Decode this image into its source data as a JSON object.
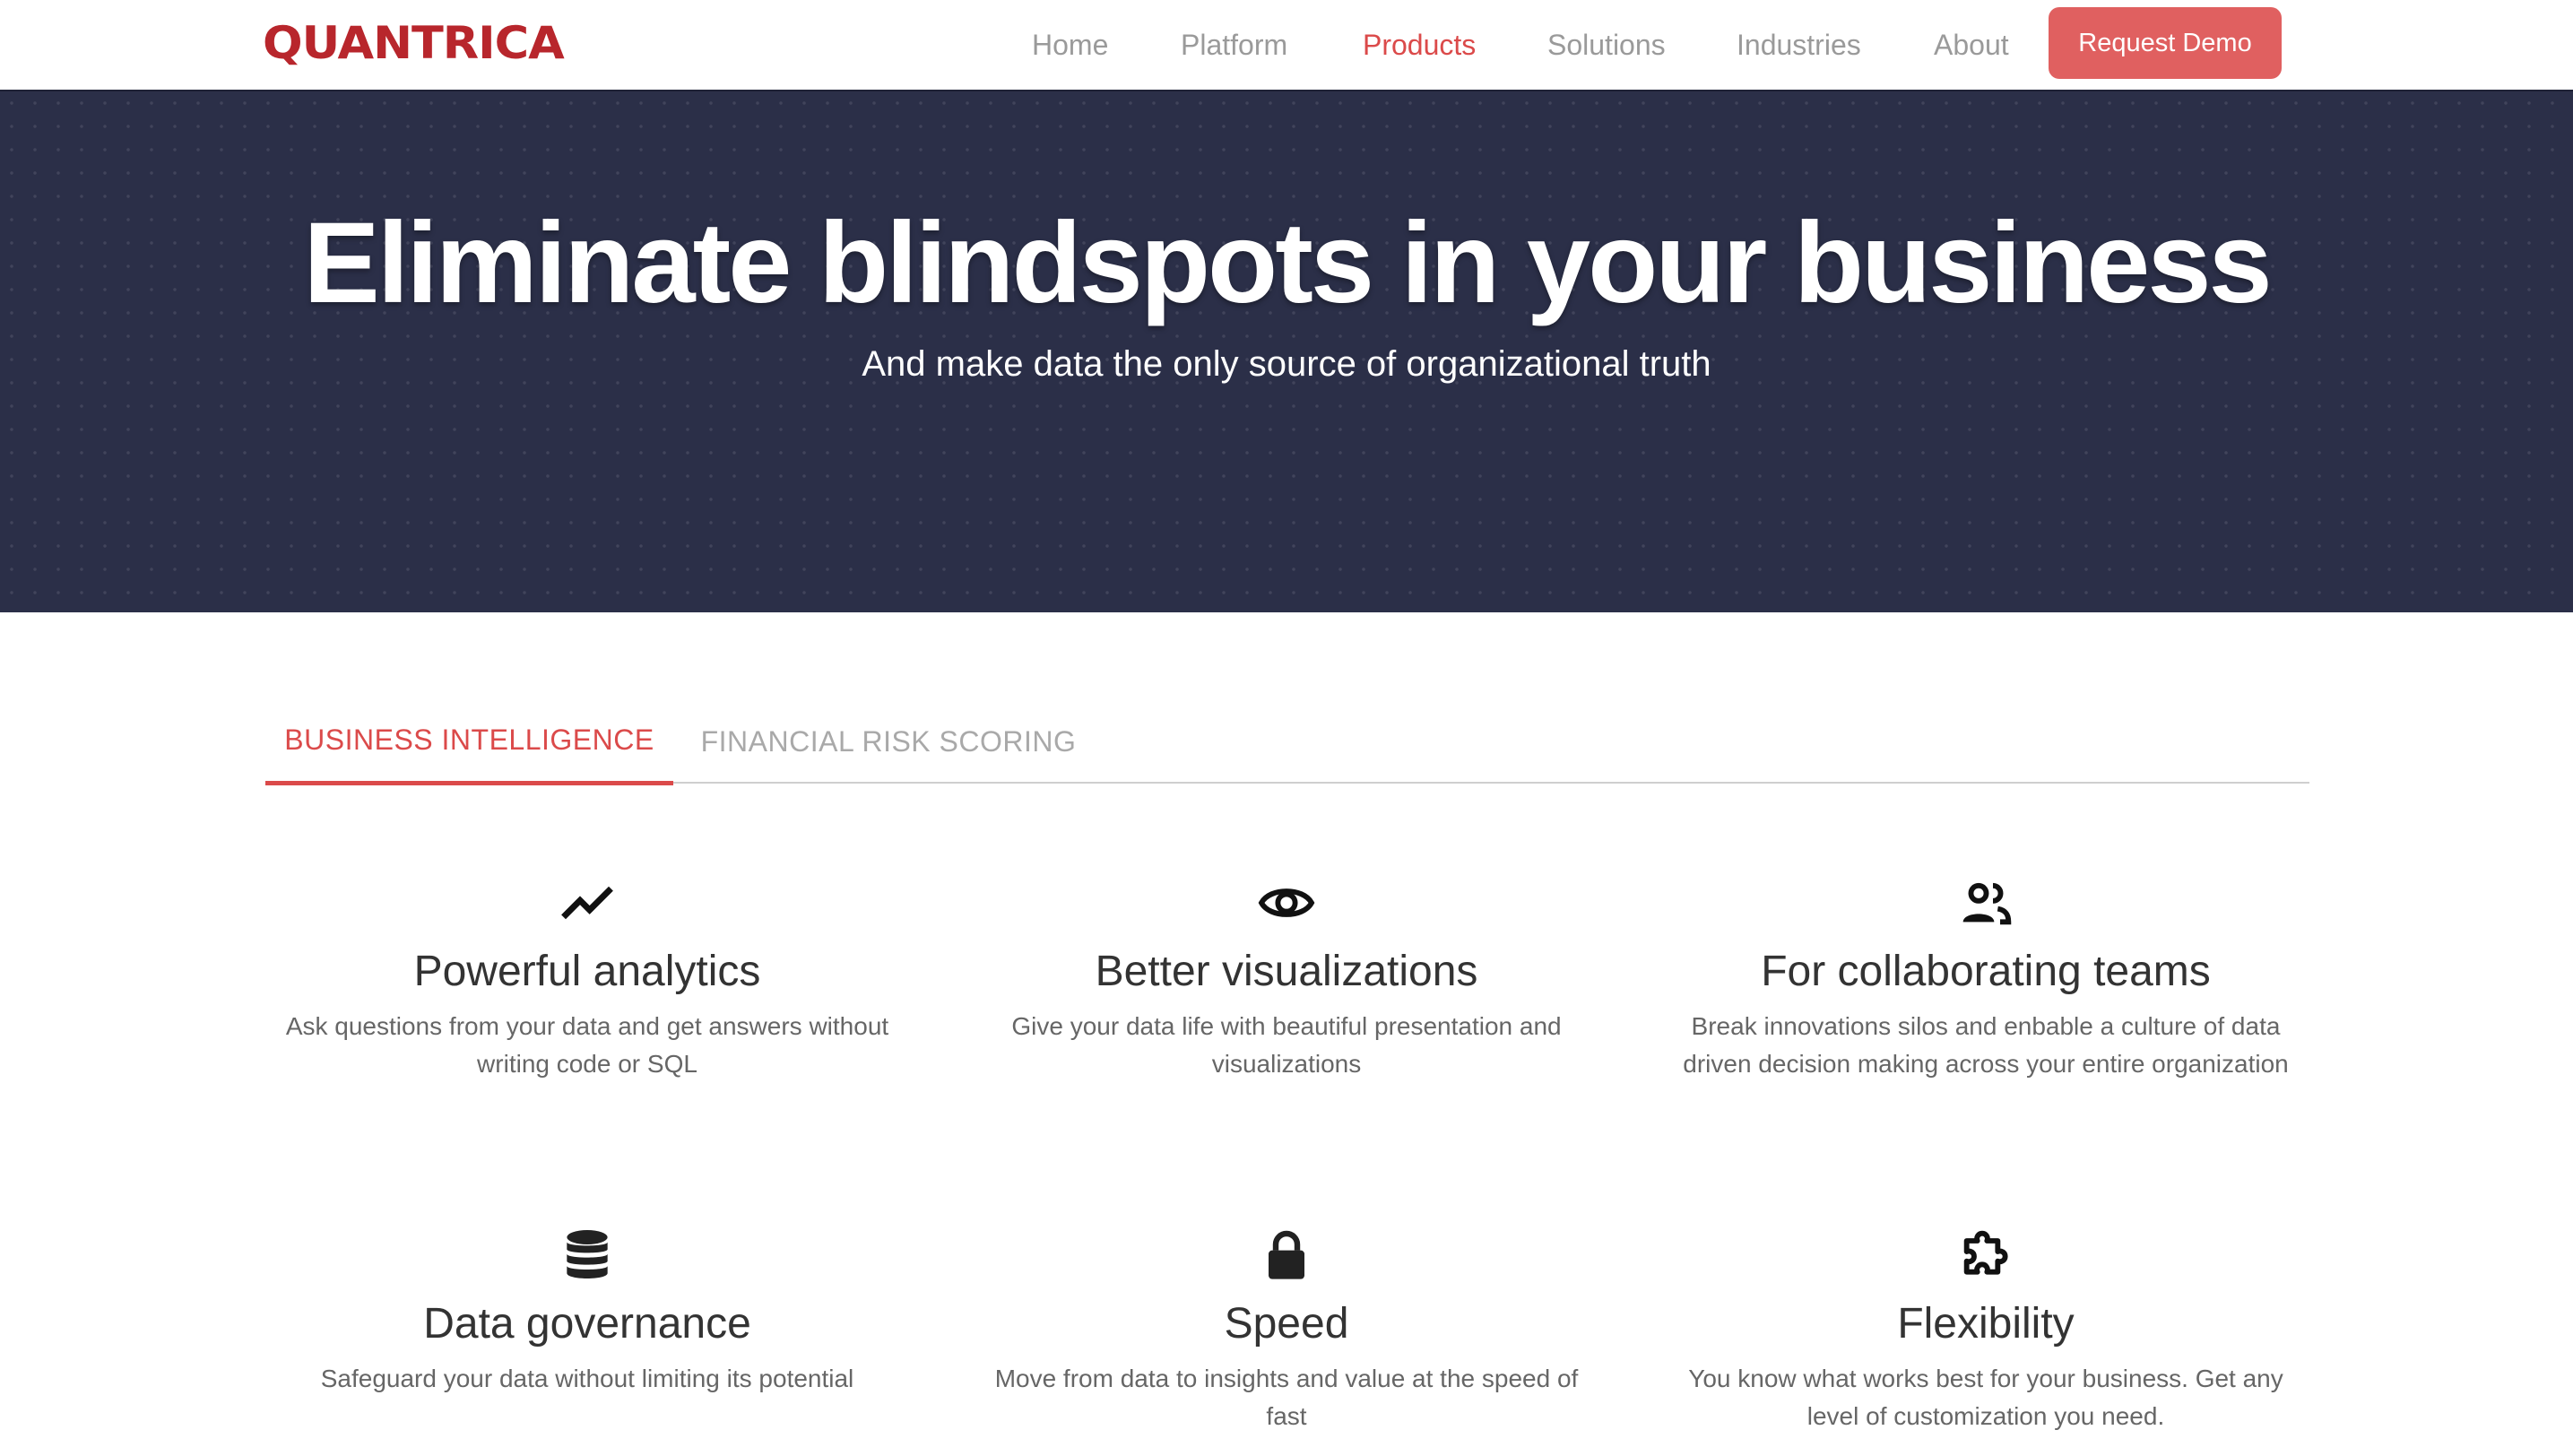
{
  "brand": {
    "logo_text": "QUANTRICA",
    "accent_color": "#db4a4a",
    "logo_color": "#b8262c"
  },
  "nav": {
    "items": [
      {
        "label": "Home",
        "active": false
      },
      {
        "label": "Platform",
        "active": false
      },
      {
        "label": "Products",
        "active": true
      },
      {
        "label": "Solutions",
        "active": false
      },
      {
        "label": "Industries",
        "active": false
      },
      {
        "label": "About",
        "active": false
      }
    ],
    "cta_label": "Request Demo"
  },
  "hero": {
    "title": "Eliminate blindspots in your business",
    "subtitle": "And make data the only source of organizational truth",
    "background_color": "#2b2f48"
  },
  "tabs": [
    {
      "label": "BUSINESS INTELLIGENCE",
      "active": true
    },
    {
      "label": "FINANCIAL RISK SCORING",
      "active": false
    }
  ],
  "features": [
    {
      "icon": "trending-up-icon",
      "title": "Powerful analytics",
      "description": "Ask questions from your data and get answers without writing code or SQL"
    },
    {
      "icon": "eye-icon",
      "title": "Better visualizations",
      "description": "Give your data life with beautiful presentation and visualizations"
    },
    {
      "icon": "people-icon",
      "title": "For collaborating teams",
      "description": "Break innovations silos and enbable a culture of data driven decision making across your entire organization"
    },
    {
      "icon": "database-icon",
      "title": "Data governance",
      "description": "Safeguard your data without limiting its potential"
    },
    {
      "icon": "lock-icon",
      "title": "Speed",
      "description": "Move from data to insights and value at the speed of fast"
    },
    {
      "icon": "puzzle-icon",
      "title": "Flexibility",
      "description": "You know what works best for your business. Get any level of customization you need."
    }
  ]
}
